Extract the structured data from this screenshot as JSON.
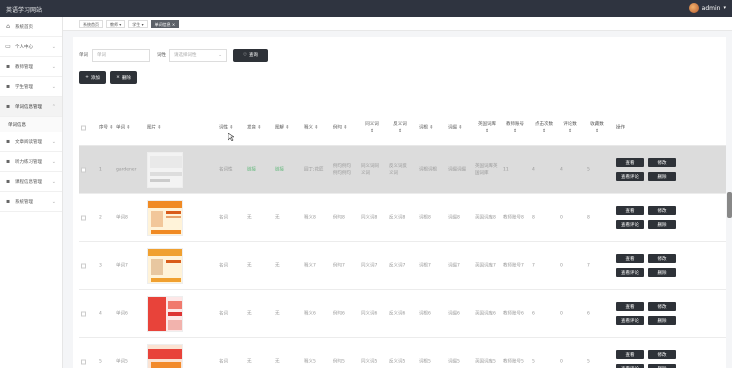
{
  "app": {
    "title": "英语学习网站",
    "user": "admin"
  },
  "sidebar": {
    "items": [
      {
        "label": "系统首页"
      },
      {
        "label": "个人中心"
      },
      {
        "label": "教师管理"
      },
      {
        "label": "学生管理"
      },
      {
        "label": "单词信息管理",
        "active": true,
        "sub": "单词信息"
      },
      {
        "label": "文章阅读管理"
      },
      {
        "label": "听力练习管理"
      },
      {
        "label": "课程信息管理"
      },
      {
        "label": "系统管理"
      }
    ]
  },
  "tabs": [
    {
      "label": "系统首页"
    },
    {
      "label": "教师"
    },
    {
      "label": "学生"
    },
    {
      "label": "单词信息",
      "active": true
    }
  ],
  "filters": {
    "word_label": "单词",
    "word_placeholder": "单词",
    "part_label": "词性",
    "part_placeholder": "请选择词性",
    "search_label": "查询"
  },
  "toolbar": {
    "add_label": "添加",
    "delete_label": "删除"
  },
  "table": {
    "headers": [
      "序号",
      "单词",
      "图片",
      "词性",
      "发音",
      "图解",
      "释义",
      "例句",
      "同义词",
      "反义词",
      "词根",
      "词缀",
      "英国词库",
      "教师账号",
      "点击次数",
      "评论数",
      "收藏数",
      "操作"
    ],
    "rows": [
      {
        "idx": "1",
        "word": "gardener",
        "pos": "名词性",
        "pron": "链接",
        "illus": "链接",
        "meaning": "园丁;花匠",
        "example": "例句例句例句例句",
        "syn": "同义词同义词",
        "ant": "反义词反义词",
        "root": "词根词根",
        "affix": "词缀词缀",
        "lib": "英国词库英国词库",
        "teacher": "11",
        "clicks": "4",
        "comments": "4",
        "favs": "5"
      },
      {
        "idx": "2",
        "word": "单词8",
        "pos": "名词",
        "pron": "无",
        "illus": "无",
        "meaning": "释义8",
        "example": "例句8",
        "syn": "同义词8",
        "ant": "反义词8",
        "root": "词根8",
        "affix": "词缀8",
        "lib": "英国词库8",
        "teacher": "教师账号8",
        "clicks": "8",
        "comments": "0",
        "favs": "8"
      },
      {
        "idx": "3",
        "word": "单词7",
        "pos": "名词",
        "pron": "无",
        "illus": "无",
        "meaning": "释义7",
        "example": "例句7",
        "syn": "同义词7",
        "ant": "反义词7",
        "root": "词根7",
        "affix": "词缀7",
        "lib": "英国词库7",
        "teacher": "教师账号7",
        "clicks": "7",
        "comments": "0",
        "favs": "7"
      },
      {
        "idx": "4",
        "word": "单词6",
        "pos": "名词",
        "pron": "无",
        "illus": "无",
        "meaning": "释义6",
        "example": "例句6",
        "syn": "同义词6",
        "ant": "反义词6",
        "root": "词根6",
        "affix": "词缀6",
        "lib": "英国词库6",
        "teacher": "教师账号6",
        "clicks": "6",
        "comments": "0",
        "favs": "6"
      },
      {
        "idx": "5",
        "word": "单词5",
        "pos": "名词",
        "pron": "无",
        "illus": "无",
        "meaning": "释义5",
        "example": "例句5",
        "syn": "同义词5",
        "ant": "反义词5",
        "root": "词根5",
        "affix": "词缀5",
        "lib": "英国词库5",
        "teacher": "教师账号5",
        "clicks": "5",
        "comments": "0",
        "favs": "5"
      }
    ],
    "ops": {
      "view": "查看",
      "edit": "修改",
      "view_comments": "查看评论",
      "delete": "删除"
    }
  }
}
